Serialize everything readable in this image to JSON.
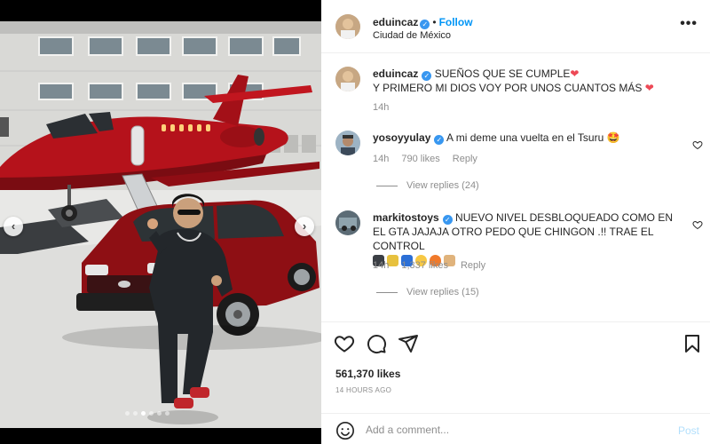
{
  "post": {
    "username": "eduincaz",
    "follow_label": "Follow",
    "separator": "•",
    "location": "Ciudad de México",
    "more_label": "•••"
  },
  "caption": {
    "username": "eduincaz",
    "line1": "SUEÑOS QUE SE CUMPLE",
    "line2": "Y PRIMERO MI DIOS VOY POR UNOS CUANTOS MÁS",
    "heart": "❤",
    "time": "14h"
  },
  "comments": [
    {
      "username": "yosoyyulay",
      "text": "A mi deme una vuelta en el Tsuru",
      "emoji": "🤩",
      "time": "14h",
      "likes": "790 likes",
      "reply": "Reply",
      "view_replies": "View replies (24)"
    },
    {
      "username": "markitostoys",
      "text": "NUEVO NIVEL DESBLOQUEADO COMO EN EL GTA JAJAJA OTRO PEDO QUE CHINGON .!! TRAE EL CONTROL",
      "emoji_names": [
        "game-controller",
        "crossed-swords",
        "blue-car",
        "grinning-face",
        "fire",
        "clapping-hands"
      ],
      "time": "14h",
      "likes": "1,337 likes",
      "reply": "Reply",
      "view_replies": "View replies (15)"
    }
  ],
  "actions": {
    "likes": "561,370 likes",
    "timestamp": "14 HOURS AGO"
  },
  "add_comment": {
    "placeholder": "Add a comment...",
    "post_label": "Post"
  },
  "carousel": {
    "prev": "‹",
    "next": "›",
    "slide_count": 6,
    "active_index": 2
  },
  "colors": {
    "verified": "#3897f0",
    "follow": "#0095f6",
    "heart": "#ed4956",
    "post_disabled": "#b2dffc",
    "plane": "#b5121b",
    "car": "#8e0f14"
  }
}
